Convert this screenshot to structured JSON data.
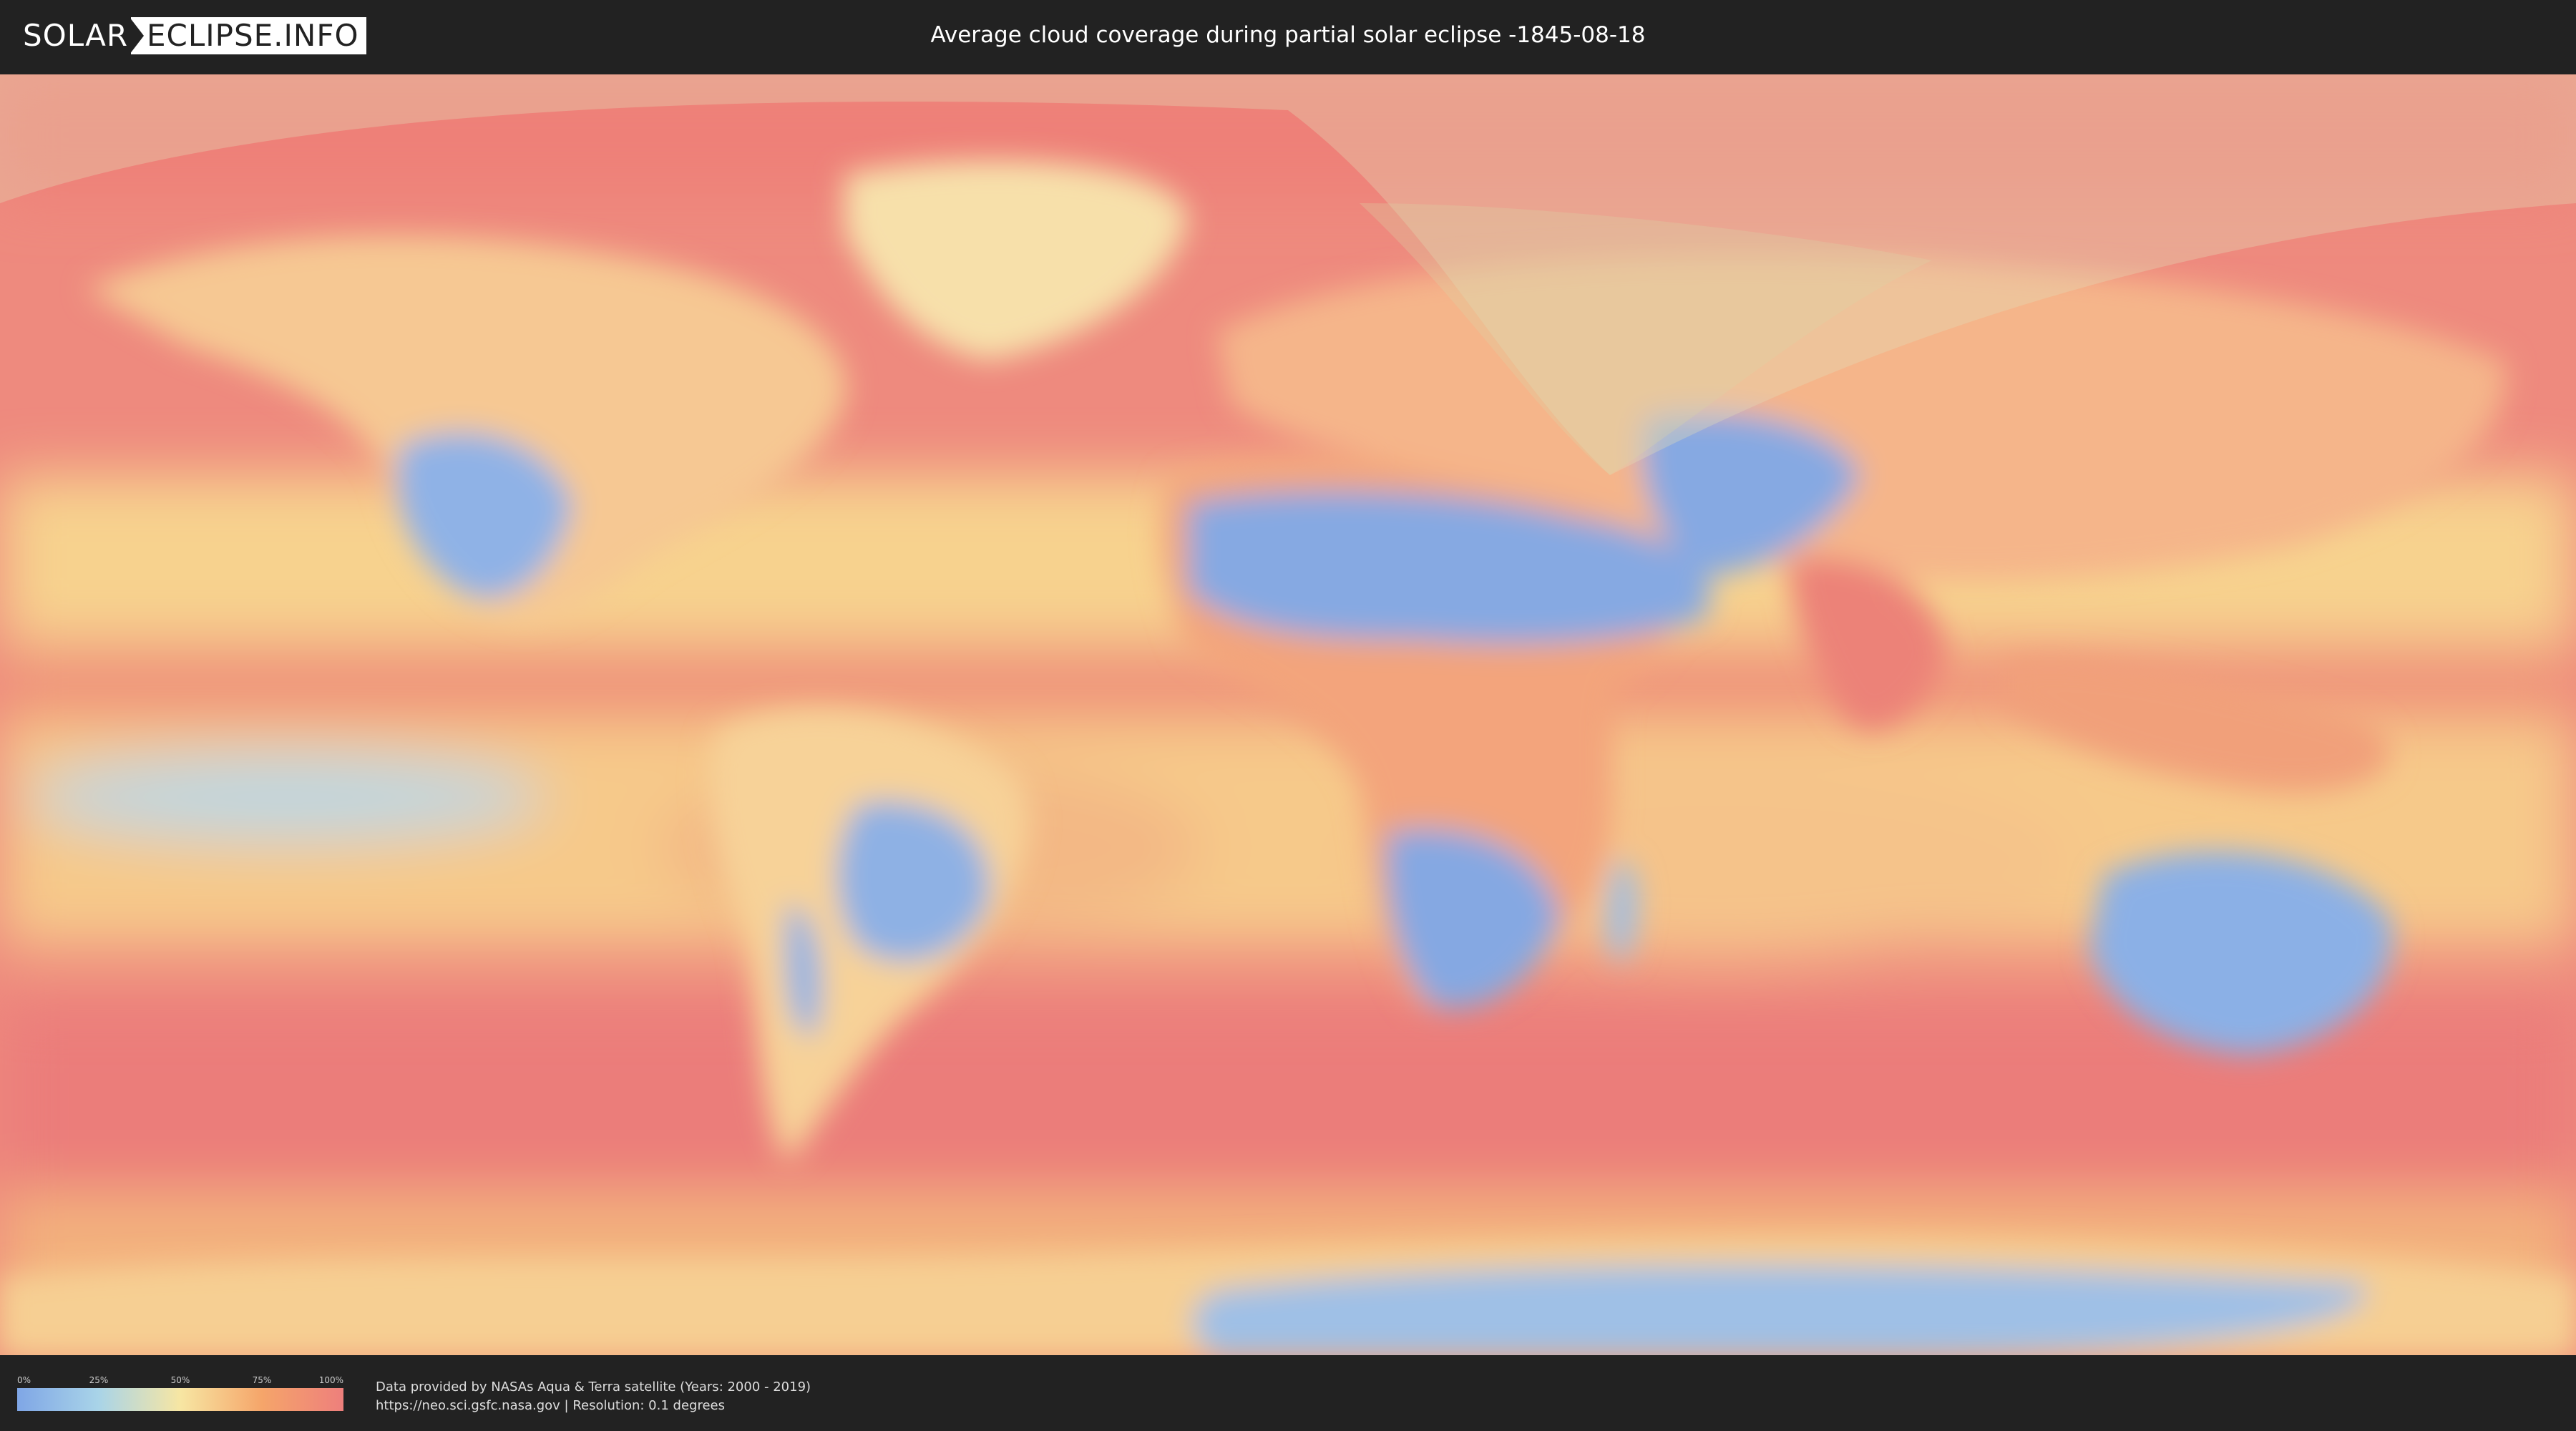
{
  "header": {
    "logo_left": "SOLAR",
    "logo_right": "ECLIPSE.INFO",
    "title": "Average cloud coverage during partial solar eclipse -1845-08-18"
  },
  "map": {
    "description_colors": {
      "clear": "#7fa6e6",
      "low": "#a9d4e8",
      "mid": "#f7e6a3",
      "high": "#f5a56a",
      "overcast": "#ee7f7c",
      "eclipse_overlay": "#d9d2a8"
    }
  },
  "legend": {
    "ticks": [
      "0%",
      "25%",
      "50%",
      "75%",
      "100%"
    ]
  },
  "footer": {
    "credit_line1": "Data provided by NASAs Aqua & Terra satellite (Years: 2000 - 2019)",
    "credit_line2": "https://neo.sci.gsfc.nasa.gov | Resolution: 0.1 degrees"
  }
}
